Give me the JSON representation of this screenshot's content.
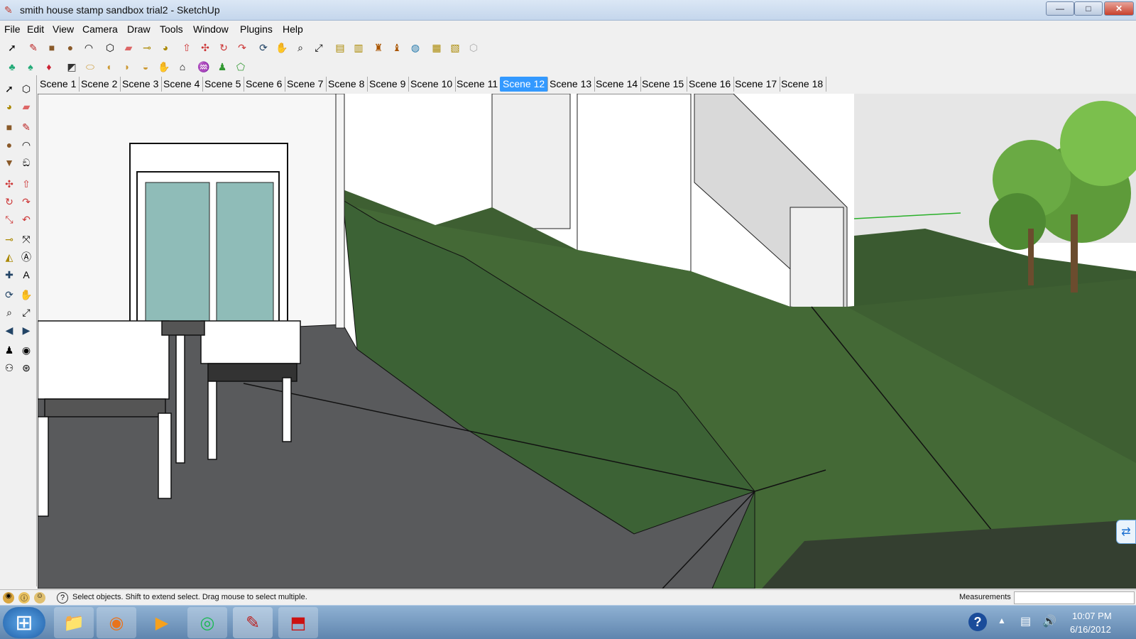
{
  "window": {
    "title": "smith house stamp sandbox trial2 - SketchUp",
    "minimize": "—",
    "maximize": "□",
    "close": "✕"
  },
  "menu": [
    "File",
    "Edit",
    "View",
    "Camera",
    "Draw",
    "Tools",
    "Window",
    "Plugins",
    "Help"
  ],
  "scenes": [
    "Scene 1",
    "Scene 2",
    "Scene 3",
    "Scene 4",
    "Scene 5",
    "Scene 6",
    "Scene 7",
    "Scene 8",
    "Scene 9",
    "Scene 10",
    "Scene 11",
    "Scene 12",
    "Scene 13",
    "Scene 14",
    "Scene 15",
    "Scene 16",
    "Scene 17",
    "Scene 18"
  ],
  "active_scene": "Scene 12",
  "status": {
    "text": "Select objects. Shift to extend select. Drag mouse to select multiple.",
    "measurements_label": "Measurements",
    "measurements_value": ""
  },
  "taskbar": {
    "time": "10:07 PM",
    "date": "6/16/2012"
  },
  "colors": {
    "accent_active_scene": "#3399ff",
    "grass": "#3e5f32",
    "pavement": "#595a5c",
    "titlebar": "#c4d6ec"
  }
}
